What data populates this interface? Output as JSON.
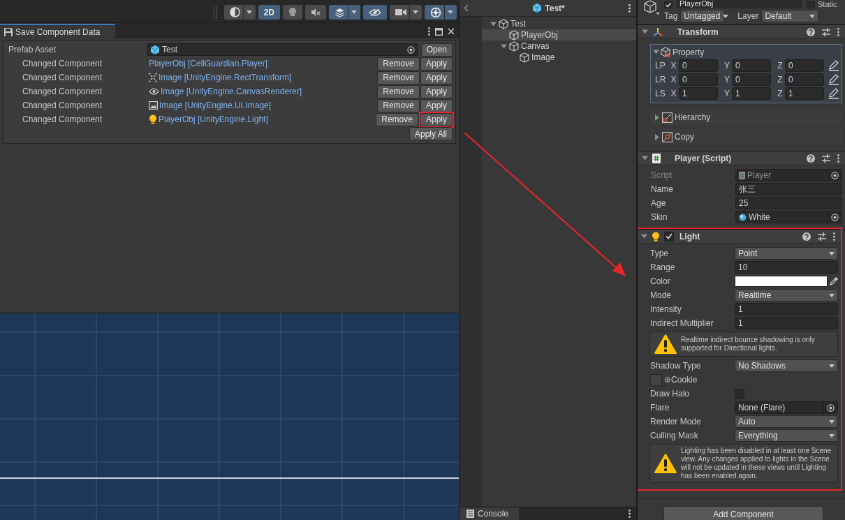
{
  "scene_toolbar": {
    "buttons": [
      {
        "kind": "shading",
        "active": false,
        "dropdown": true
      },
      {
        "kind": "label",
        "label": "2D",
        "active": true,
        "dropdown": false
      },
      {
        "kind": "lighting",
        "active": false,
        "dropdown": false
      },
      {
        "kind": "audio",
        "active": false,
        "dropdown": false
      },
      {
        "kind": "effects",
        "active": true,
        "dropdown": true
      },
      {
        "kind": "visibility",
        "active": true,
        "dropdown": false
      },
      {
        "kind": "camera",
        "active": false,
        "dropdown": true
      },
      {
        "kind": "gizmos",
        "active": true,
        "dropdown": true
      }
    ]
  },
  "save_window": {
    "title": "Save Component Data",
    "prefab_label": "Prefab Asset",
    "prefab_value": "Test",
    "open_button": "Open",
    "rows": [
      {
        "label": "Changed Component",
        "kind": "plain",
        "component": "PlayerObj [CellGuardian.Player]",
        "remove": "Remove",
        "apply": "Apply",
        "highlighted": false
      },
      {
        "label": "Changed Component",
        "kind": "recttransform",
        "component": "Image [UnityEngine.RectTransform]",
        "remove": "Remove",
        "apply": "Apply",
        "highlighted": false
      },
      {
        "label": "Changed Component",
        "kind": "renderer",
        "component": "Image [UnityEngine.CanvasRenderer]",
        "remove": "Remove",
        "apply": "Apply",
        "highlighted": false
      },
      {
        "label": "Changed Component",
        "kind": "image",
        "component": "Image [UnityEngine.UI.Image]",
        "remove": "Remove",
        "apply": "Apply",
        "highlighted": false
      },
      {
        "label": "Changed Component",
        "kind": "light",
        "component": "PlayerObj [UnityEngine.Light]",
        "remove": "Remove",
        "apply": "Apply",
        "highlighted": true
      }
    ],
    "apply_all": "Apply All"
  },
  "hierarchy": {
    "title": "Test*",
    "items": [
      {
        "name": "Test",
        "expanded": true,
        "selected": false,
        "children": [
          {
            "name": "PlayerObj",
            "selected": true
          },
          {
            "name": "Canvas",
            "expanded": true,
            "selected": false,
            "children": [
              {
                "name": "Image",
                "selected": false
              }
            ]
          }
        ]
      }
    ]
  },
  "console_tab": "Console",
  "inspector": {
    "active": true,
    "object_name": "PlayerObj",
    "static": false,
    "static_label": "Static",
    "tag_label": "Tag",
    "tag": "Untagged",
    "layer_label": "Layer",
    "layer": "Default",
    "components": [
      {
        "kind": "transform",
        "title": "Transform",
        "expanded": true,
        "property": {
          "label": "Property",
          "expanded": true,
          "rows": [
            {
              "label": "LP",
              "fields": [
                {
                  "axis": "X",
                  "value": "0"
                },
                {
                  "axis": "Y",
                  "value": "0"
                },
                {
                  "axis": "Z",
                  "value": "0"
                }
              ]
            },
            {
              "label": "LR",
              "fields": [
                {
                  "axis": "X",
                  "value": "0"
                },
                {
                  "axis": "Y",
                  "value": "0"
                },
                {
                  "axis": "Z",
                  "value": "0"
                }
              ]
            },
            {
              "label": "LS",
              "fields": [
                {
                  "axis": "X",
                  "value": "1"
                },
                {
                  "axis": "Y",
                  "value": "1"
                },
                {
                  "axis": "Z",
                  "value": "1"
                }
              ]
            }
          ]
        },
        "foldouts": [
          {
            "label": "Hierarchy",
            "kind": "hierarchy",
            "expanded": false
          },
          {
            "label": "Copy",
            "kind": "copy",
            "expanded": false
          }
        ]
      },
      {
        "kind": "script",
        "title": "Player (Script)",
        "expanded": true,
        "fields": [
          {
            "kind": "scriptref",
            "label": "Script",
            "value": "Player",
            "disabled": true
          },
          {
            "kind": "text",
            "label": "Name",
            "value": "张三",
            "disabled": false
          },
          {
            "kind": "text",
            "label": "Age",
            "value": "25",
            "disabled": false
          },
          {
            "kind": "material",
            "label": "Skin",
            "value": "White",
            "disabled": false
          }
        ]
      },
      {
        "kind": "light",
        "title": "Light",
        "expanded": true,
        "enabled": true,
        "highlighted": true,
        "fields": [
          {
            "kind": "dropdown",
            "label": "Type",
            "value": "Point"
          },
          {
            "kind": "text",
            "label": "Range",
            "value": "10"
          },
          {
            "kind": "color",
            "label": "Color"
          },
          {
            "kind": "dropdown",
            "label": "Mode",
            "value": "Realtime"
          },
          {
            "kind": "text",
            "label": "Intensity",
            "value": "1"
          },
          {
            "kind": "text",
            "label": "Indirect Multiplier",
            "value": "1"
          },
          {
            "kind": "warning",
            "message": "Realtime indirect bounce shadowing is only supported for Directional lights."
          },
          {
            "kind": "dropdown",
            "label": "Shadow Type",
            "value": "No Shadows"
          },
          {
            "kind": "texture",
            "label": "Cookie"
          },
          {
            "kind": "toggle",
            "label": "Draw Halo",
            "checked": false
          },
          {
            "kind": "object",
            "label": "Flare",
            "value": "None (Flare)"
          },
          {
            "kind": "dropdown",
            "label": "Render Mode",
            "value": "Auto"
          },
          {
            "kind": "dropdown",
            "label": "Culling Mask",
            "value": "Everything"
          },
          {
            "kind": "warning",
            "message": "Lighting has been disabled in at least one Scene view. Any changes applied to lights in the Scene will not be updated in these views until Lighting has been enabled again."
          }
        ]
      }
    ],
    "add_component": "Add Component"
  }
}
